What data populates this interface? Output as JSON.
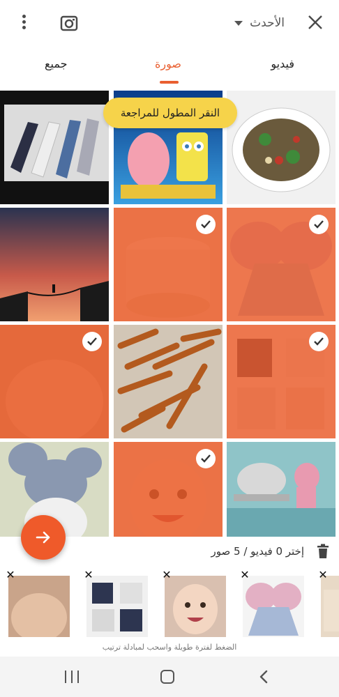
{
  "header": {
    "sort_label": "الأحدث"
  },
  "tabs": [
    {
      "label": "جميع"
    },
    {
      "label": "صورة"
    },
    {
      "label": "فيديو"
    }
  ],
  "tooltip": "النقر المطول للمراجعة",
  "grid": {
    "cells": [
      {
        "subject": "phones",
        "selected": false
      },
      {
        "subject": "spongebob-movie",
        "selected": false
      },
      {
        "subject": "salad-plate",
        "selected": false
      },
      {
        "subject": "sunset-bridge",
        "selected": false
      },
      {
        "subject": "cake",
        "selected": true
      },
      {
        "subject": "butterfly-dress",
        "selected": true
      },
      {
        "subject": "baby-face",
        "selected": true
      },
      {
        "subject": "fries",
        "selected": false
      },
      {
        "subject": "baby-outfits",
        "selected": true
      },
      {
        "subject": "cartoon-mouse",
        "selected": false
      },
      {
        "subject": "smiling-baby",
        "selected": true
      },
      {
        "subject": "pink-panther",
        "selected": false
      }
    ]
  },
  "selection": {
    "summary": "إختر 0 فيديو / 5 صور",
    "hint": "الضغط لفترة طويلة واسحب لمبادلة ترتيب"
  },
  "tray": [
    {
      "subject": "baby-face"
    },
    {
      "subject": "baby-outfits"
    },
    {
      "subject": "smiling-baby"
    },
    {
      "subject": "butterfly-dress"
    },
    {
      "subject": "cake"
    }
  ],
  "colors": {
    "accent": "#e95f30",
    "tooltip": "#f6d34a"
  }
}
